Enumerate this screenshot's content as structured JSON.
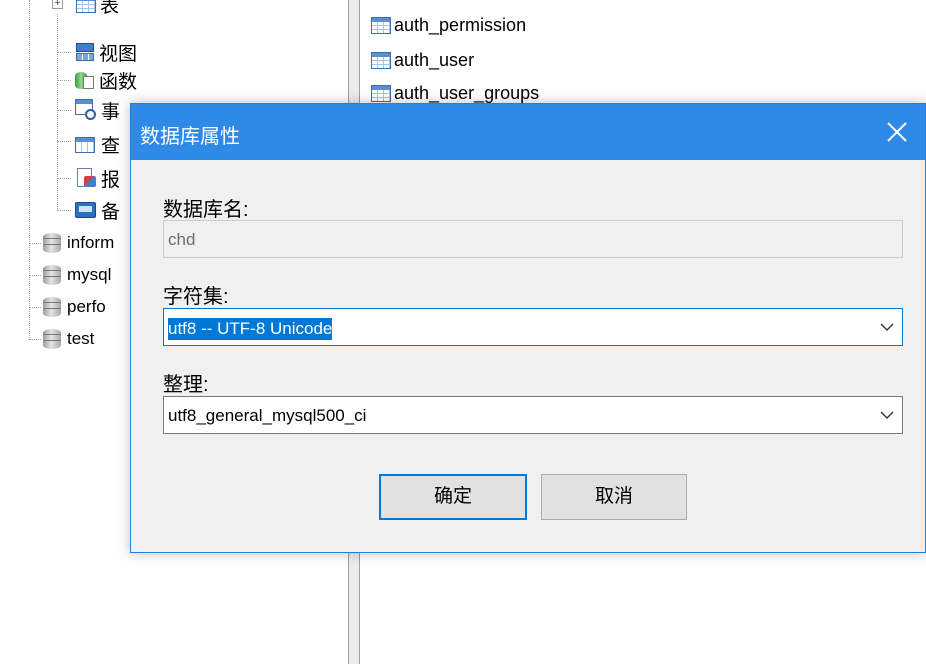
{
  "tree": {
    "nodes": [
      {
        "label": "表"
      },
      {
        "label": "视图"
      },
      {
        "label": "函数"
      },
      {
        "label": "事"
      },
      {
        "label": "查"
      },
      {
        "label": "报"
      },
      {
        "label": "备"
      }
    ],
    "databases": [
      {
        "label": "inform"
      },
      {
        "label": "mysql"
      },
      {
        "label": "perfo"
      },
      {
        "label": "test"
      }
    ]
  },
  "right_pane": {
    "items": [
      {
        "label": "auth_permission"
      },
      {
        "label": "auth_user"
      },
      {
        "label": "auth_user_groups"
      }
    ]
  },
  "dialog": {
    "title": "数据库属性",
    "db_name_label": "数据库名:",
    "db_name_value": "chd",
    "charset_label": "字符集:",
    "charset_value": "utf8 -- UTF-8 Unicode",
    "collation_label": "整理:",
    "collation_value": "utf8_general_mysql500_ci",
    "ok_label": "确定",
    "cancel_label": "取消"
  },
  "colors": {
    "title_bar": "#2e8ae6",
    "selection": "#0078d7",
    "dialog_bg": "#f0f0f0"
  },
  "icons": {
    "table": "table-grid-icon",
    "view": "view-icon",
    "function": "function-icon",
    "event": "event-clock-icon",
    "query": "query-icon",
    "report": "report-icon",
    "backup": "backup-icon",
    "database": "database-cylinder-icon",
    "close": "close-icon",
    "dropdown": "chevron-down-icon"
  }
}
